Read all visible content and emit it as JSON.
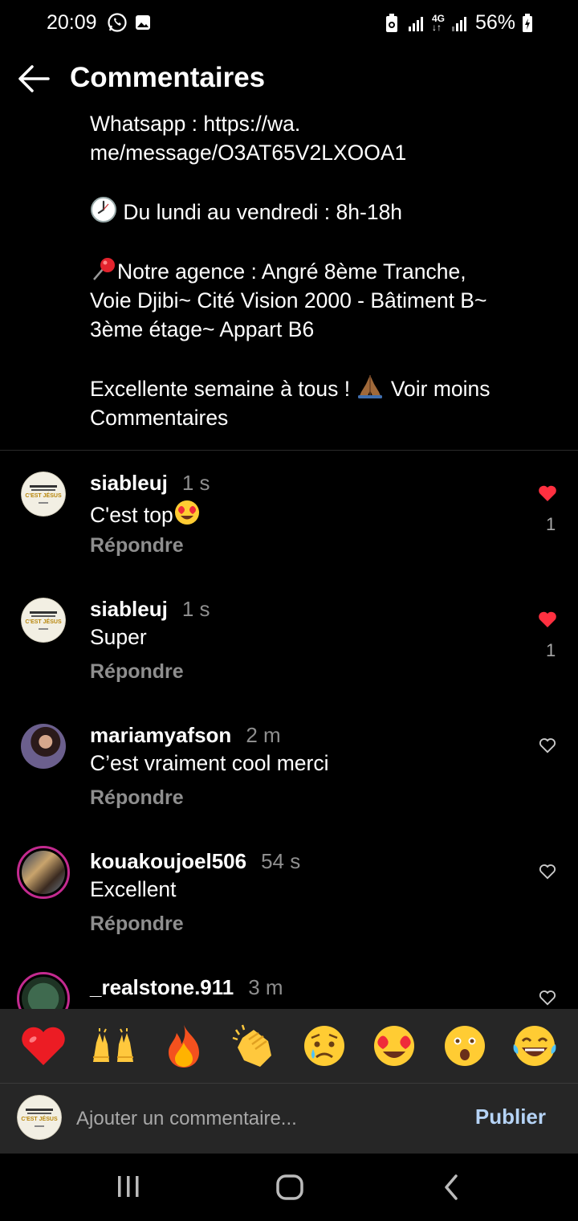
{
  "status_bar": {
    "time": "20:09",
    "battery": "56%",
    "network": "4G"
  },
  "header": {
    "title": "Commentaires"
  },
  "caption": {
    "line_whatsapp": "Whatsapp : https://wa.",
    "line_whatsapp_2": "me/message/O3AT65V2LXOOA1",
    "hours": " Du lundi au vendredi : 8h-18h",
    "agency_1": "Notre agence : Angré 8ème Tranche,",
    "agency_2": "Voie Djibi~ Cité Vision 2000 - Bâtiment B~",
    "agency_3": "3ème étage~ Appart B6",
    "closing": "Excellente semaine à tous ! ",
    "voir_moins": "Voir moins",
    "comments_label": "Commentaires"
  },
  "comments": [
    {
      "user": "siableuj",
      "time": "1 s",
      "text": "C'est top",
      "reply": "Répondre",
      "liked": true,
      "likes": "1"
    },
    {
      "user": "siableuj",
      "time": "1 s",
      "text": "Super",
      "reply": "Répondre",
      "liked": true,
      "likes": "1"
    },
    {
      "user": "mariamyafson",
      "time": "2 m",
      "text": "C’est vraiment cool merci",
      "reply": "Répondre",
      "liked": false,
      "likes": ""
    },
    {
      "user": "kouakoujoel506",
      "time": "54 s",
      "text": "Excellent",
      "reply": "Répondre",
      "liked": false,
      "likes": ""
    },
    {
      "user": "_realstone.911",
      "time": "3 m",
      "text": "",
      "reply": "",
      "liked": false,
      "likes": ""
    }
  ],
  "emoji_bar": {
    "emojis": [
      "heart",
      "raising-hands",
      "fire",
      "clapping-hands",
      "sad-relieved-face",
      "heart-eyes-face",
      "astonished-face",
      "tears-of-joy-face"
    ]
  },
  "comment_input": {
    "placeholder": "Ajouter un commentaire...",
    "publish_label": "Publier"
  },
  "colors": {
    "background": "#000000",
    "secondary_text": "#8e8e8e",
    "like_red": "#ff3040",
    "publish_blue": "#b5d3f6",
    "bar_bg": "#262626"
  }
}
